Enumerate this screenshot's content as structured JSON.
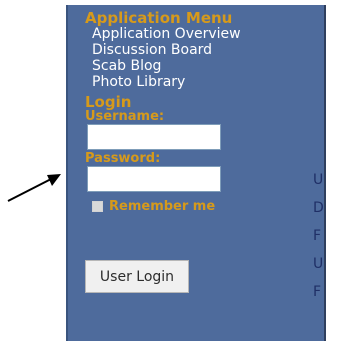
{
  "menu": {
    "title": "Application Menu",
    "items": [
      {
        "label": "Application Overview"
      },
      {
        "label": "Discussion Board"
      },
      {
        "label": "Scab Blog"
      },
      {
        "label": "Photo Library"
      }
    ]
  },
  "login": {
    "title": "Login",
    "username_label": "Username:",
    "username_value": "",
    "password_label": "Password:",
    "password_value": "",
    "remember_label": "Remember me",
    "button_label": "User Login"
  },
  "right_column": {
    "letters": [
      "U",
      "D",
      "F",
      "U",
      "F"
    ]
  }
}
